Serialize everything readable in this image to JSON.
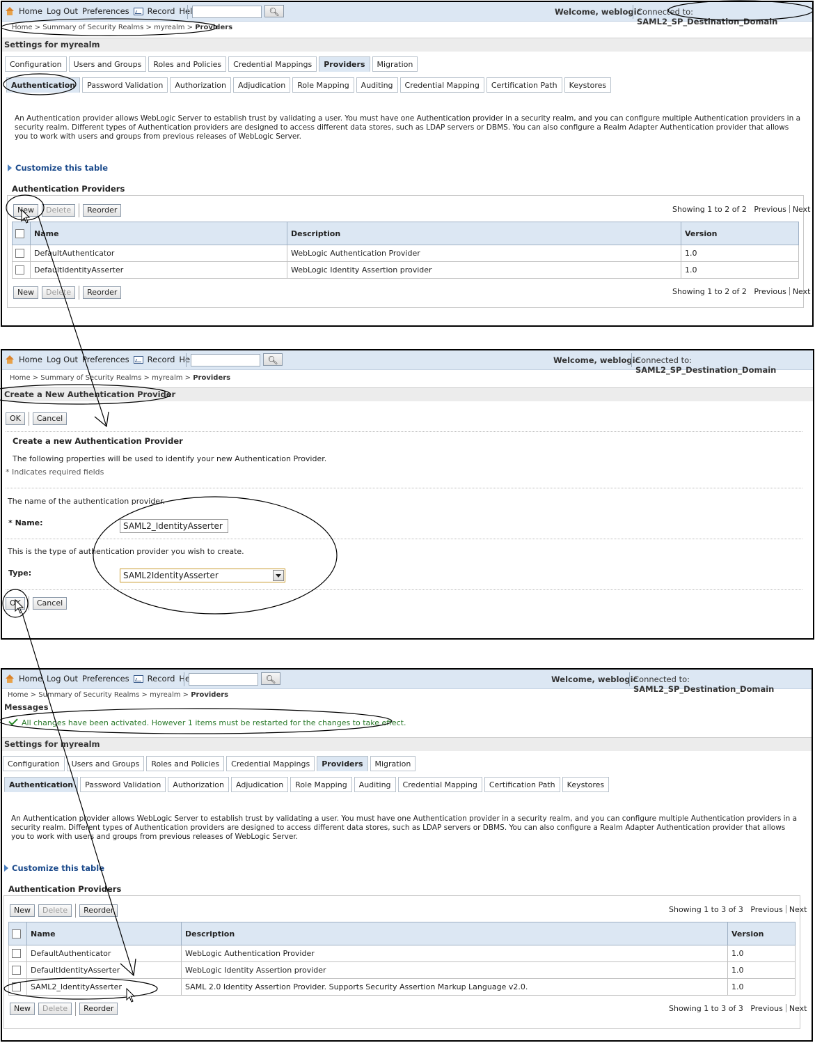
{
  "topbar": {
    "home": "Home",
    "logout": "Log Out",
    "preferences": "Preferences",
    "record": "Record",
    "help": "Help",
    "welcome": "Welcome, weblogic",
    "connected_prefix": "Connected to: ",
    "domain": "SAML2_SP_Destination_Domain"
  },
  "breadcrumb": {
    "home": "Home >",
    "summary": "Summary of Security Realms >",
    "realm": "myrealm >",
    "current": "Providers"
  },
  "settings_title": "Settings for myrealm",
  "messages_title": "Messages",
  "top_tabs": [
    "Configuration",
    "Users and Groups",
    "Roles and Policies",
    "Credential Mappings",
    "Providers",
    "Migration"
  ],
  "sub_tabs": [
    "Authentication",
    "Password Validation",
    "Authorization",
    "Adjudication",
    "Role Mapping",
    "Auditing",
    "Credential Mapping",
    "Certification Path",
    "Keystores"
  ],
  "description": "An Authentication provider allows WebLogic Server to establish trust by validating a user. You must have one Authentication provider in a security realm, and you can configure multiple Authentication providers in a security realm. Different types of Authentication providers are designed to access different data stores, such as LDAP servers or DBMS. You can also configure a Realm Adapter Authentication provider that allows you to work with users and groups from previous releases of WebLogic Server.",
  "customize_label": "Customize this table",
  "table_title": "Authentication Providers",
  "buttons": {
    "new": "New",
    "delete": "Delete",
    "reorder": "Reorder",
    "ok": "OK",
    "cancel": "Cancel"
  },
  "paging": {
    "previous": "Previous",
    "next": "Next",
    "showing_2": "Showing 1 to 2 of 2",
    "showing_3": "Showing 1 to 3 of 3"
  },
  "columns": {
    "name": "Name",
    "description": "Description",
    "version": "Version"
  },
  "providers_before": [
    {
      "name": "DefaultAuthenticator",
      "description": "WebLogic Authentication Provider",
      "version": "1.0"
    },
    {
      "name": "DefaultIdentityAsserter",
      "description": "WebLogic Identity Assertion provider",
      "version": "1.0"
    }
  ],
  "providers_after": [
    {
      "name": "DefaultAuthenticator",
      "description": "WebLogic Authentication Provider",
      "version": "1.0"
    },
    {
      "name": "DefaultIdentityAsserter",
      "description": "WebLogic Identity Assertion provider",
      "version": "1.0"
    },
    {
      "name": "SAML2_IdentityAsserter",
      "description": "SAML 2.0 Identity Assertion Provider. Supports Security Assertion Markup Language v2.0.",
      "version": "1.0"
    }
  ],
  "create": {
    "page_title": "Create a New Authentication Provider",
    "heading": "Create a new Authentication Provider",
    "intro": "The following properties will be used to identify your new Authentication Provider.",
    "required_note": "* Indicates required fields",
    "name_help": "The name of the authentication provider.",
    "name_label": "* Name:",
    "name_value": "SAML2_IdentityAsserter",
    "type_help": "This is the type of authentication provider you wish to create.",
    "type_label": "Type:",
    "type_value": "SAML2IdentityAsserter"
  },
  "message": "All changes have been activated. However 1 items must be restarted for the changes to take effect.",
  "colors": {
    "header_bg": "#dce7f3",
    "link": "#1c4b8c",
    "success": "#2a7a2a"
  }
}
